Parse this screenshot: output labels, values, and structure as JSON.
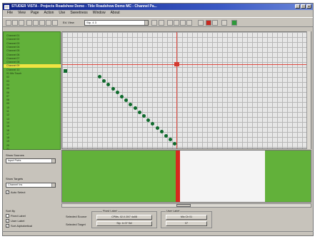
{
  "window": {
    "title": "STUDER VISTA - Projects Roadshow Demo - Title Roadshow Demo MC - Channel Pa...",
    "controls": [
      "_",
      "□",
      "x"
    ]
  },
  "menu": [
    "File",
    "View",
    "Page",
    "Action",
    "Use",
    "Sweetness",
    "Window",
    "About"
  ],
  "toolbar": {
    "view_label": "Ed. View",
    "view_value": "Stp. 4  3"
  },
  "sources": {
    "rows": [
      "Channel 01",
      "Channel 02",
      "Channel 03",
      "Channel 04",
      "Channel 05",
      "Channel 06",
      "Channel 07",
      "Channel 08",
      "Channel 09",
      "Channel 10",
      "01 Mic Touch",
      "02",
      "03",
      "04",
      "05",
      "06",
      "07",
      "08",
      "09",
      "10",
      "11",
      "12",
      "13",
      "14",
      "15",
      "16",
      "17",
      "18",
      "19",
      "20",
      "21"
    ],
    "selected_index": 8
  },
  "left_controls": {
    "show_sources_label": "Show Sources",
    "show_sources_value": "Input Ports",
    "show_targets_label": "Show Targets",
    "show_targets_value": "Channel Ins",
    "auto_select_label": "Auto Select",
    "sort_by_label": "Sort By",
    "sort_options": [
      "Fixed Label",
      "User Label",
      "Sort Alphabetical"
    ]
  },
  "label_groups": {
    "fixed_label_title": "Fixed Label",
    "user_label_title": "User Label",
    "selected_source_label": "Selected Source",
    "selected_target_label": "Selected Target",
    "fixed_source_value": "CPMs. 02.0 20/7 4u08",
    "fixed_target_value": "Stp. In 07 Sel",
    "user_source_value": "Mic Ch 01",
    "user_target_value": "07"
  },
  "colors": {
    "panel_green": "#62b13a",
    "cursor_red": "#d43a30",
    "selection_yellow": "#f0e442",
    "patch_dot": "#0e6a2c"
  }
}
